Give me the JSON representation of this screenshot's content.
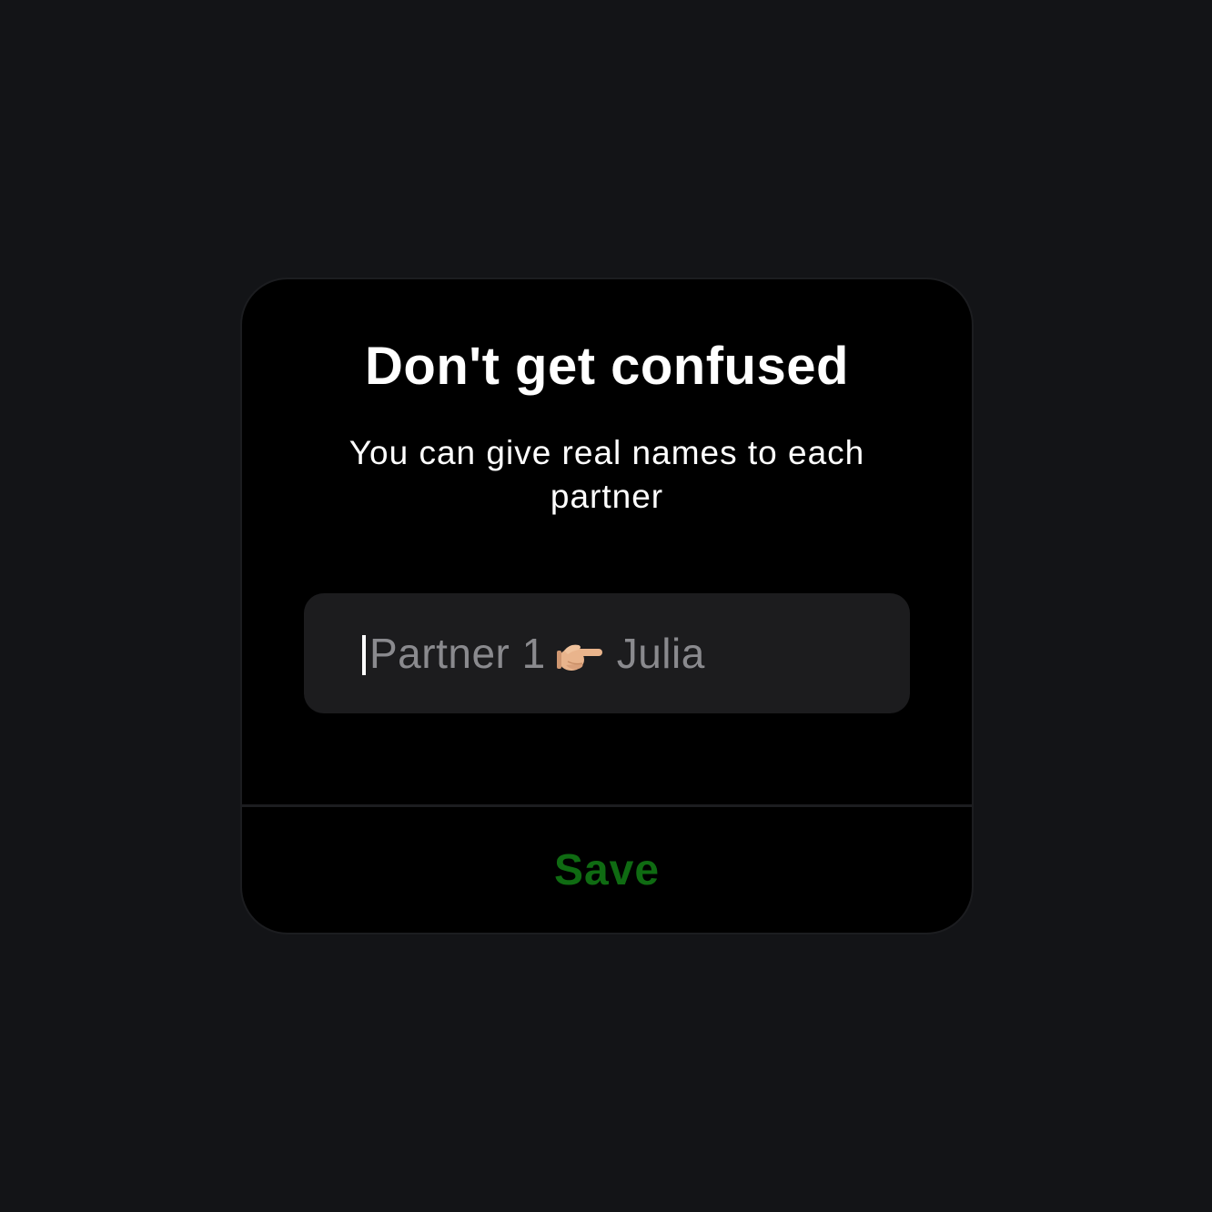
{
  "dialog": {
    "title": "Don't get confused",
    "message": "You can give real names to each partner",
    "input": {
      "value": "",
      "placeholder_before": "Partner 1",
      "placeholder_icon": "backhand-index-pointing-right-icon",
      "placeholder_after": "Julia"
    },
    "save_label": "Save"
  },
  "colors": {
    "background": "#131417",
    "dialog_background": "#000000",
    "field_background": "#1c1c1e",
    "placeholder_text": "#8a8a8e",
    "save_accent": "#0f6b12"
  }
}
